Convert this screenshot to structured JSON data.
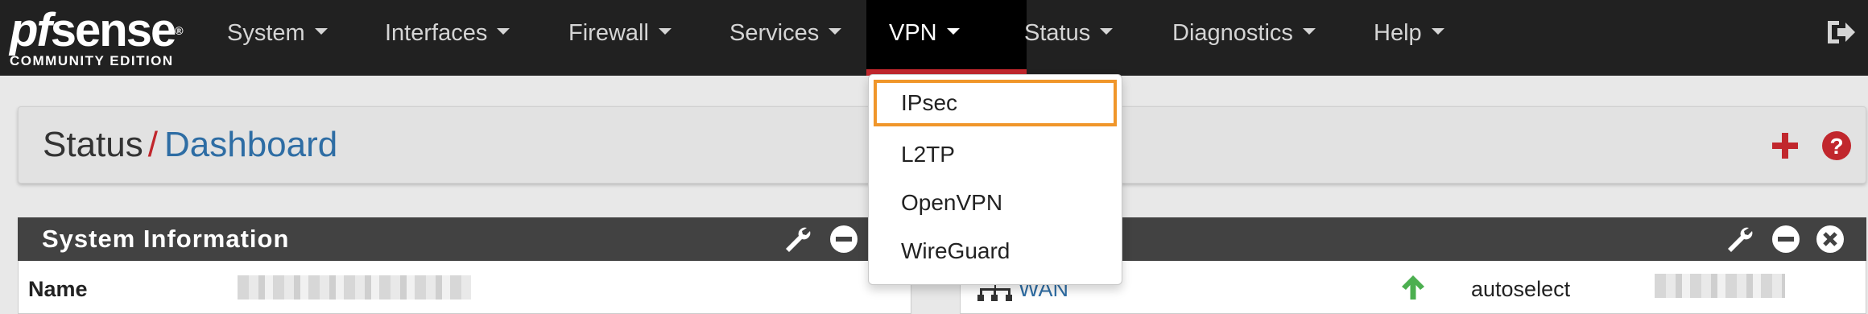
{
  "navbar": {
    "logo": {
      "brand_pf": "pf",
      "brand_sense": "sense",
      "brand_mark": "®",
      "edition": "COMMUNITY EDITION"
    },
    "items": [
      {
        "label": "System"
      },
      {
        "label": "Interfaces"
      },
      {
        "label": "Firewall"
      },
      {
        "label": "Services"
      },
      {
        "label": "VPN",
        "active": true
      },
      {
        "label": "Status"
      },
      {
        "label": "Diagnostics"
      },
      {
        "label": "Help"
      }
    ],
    "logout_icon": "sign-out-icon"
  },
  "vpn_menu": {
    "items": [
      {
        "label": "IPsec",
        "highlighted": true
      },
      {
        "label": "L2TP"
      },
      {
        "label": "OpenVPN"
      },
      {
        "label": "WireGuard"
      }
    ]
  },
  "breadcrumb": {
    "section": "Status",
    "separator": "/",
    "page": "Dashboard",
    "actions": {
      "add_icon": "plus-icon",
      "help_icon": "question-circle-icon"
    }
  },
  "panels": {
    "system_info": {
      "title": "System Information",
      "rows": [
        {
          "label": "Name"
        }
      ]
    },
    "interfaces": {
      "rows": [
        {
          "name": "WAN",
          "status_icon": "arrow-up-icon",
          "media": "autoselect"
        }
      ]
    },
    "panel_icons": [
      "wrench-icon",
      "minus-circle-icon",
      "close-circle-icon"
    ]
  },
  "colors": {
    "navbar_bg": "#212121",
    "active_underline": "#c1272d",
    "link_blue": "#2e6da4",
    "highlight_orange": "#f0962a",
    "status_up_green": "#4caf50",
    "panel_header": "#424242"
  }
}
